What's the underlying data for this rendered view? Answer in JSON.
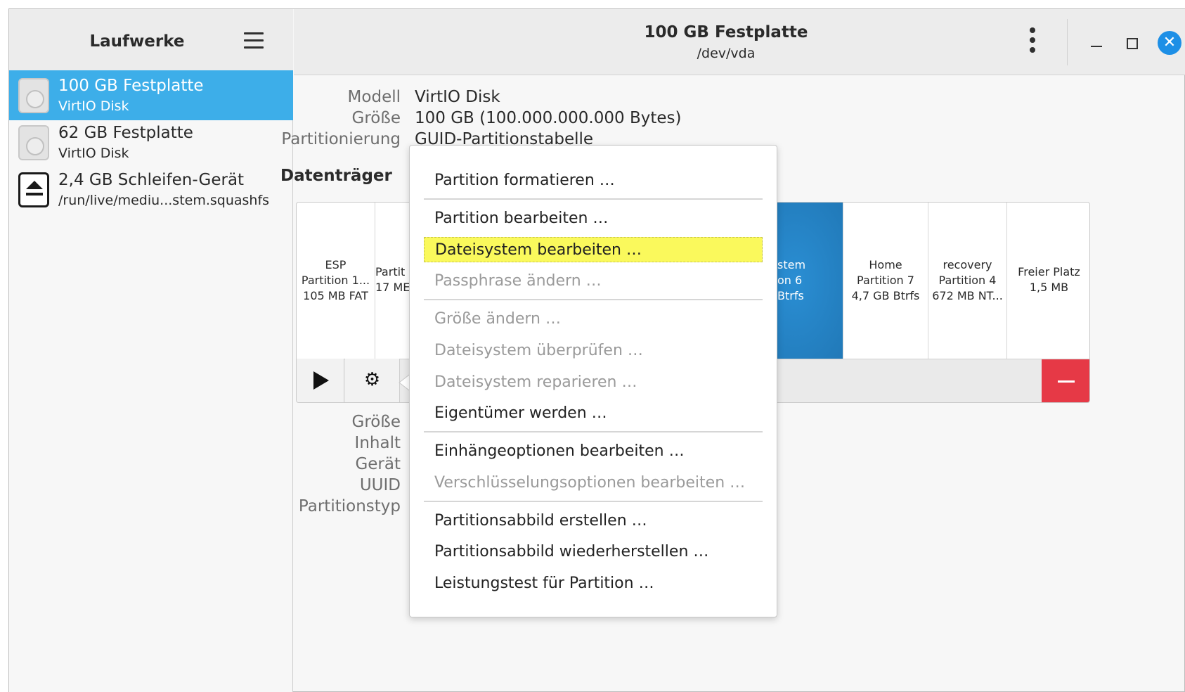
{
  "sidebar": {
    "title": "Laufwerke",
    "drives": [
      {
        "name": "100 GB Festplatte",
        "sub": "VirtIO Disk",
        "icon": "hard-disk-icon",
        "selected": true
      },
      {
        "name": "62 GB Festplatte",
        "sub": "VirtIO Disk",
        "icon": "hard-disk-icon",
        "selected": false
      },
      {
        "name": "2,4 GB Schleifen-Gerät",
        "sub": "/run/live/mediu...stem.squashfs",
        "icon": "eject-icon",
        "selected": false
      }
    ]
  },
  "header": {
    "title": "100 GB Festplatte",
    "subtitle": "/dev/vda",
    "close_glyph": "✕"
  },
  "disk_info": {
    "model_label": "Modell",
    "model_value": "VirtIO Disk",
    "size_label": "Größe",
    "size_value": "100 GB (100.000.000.000 Bytes)",
    "partitioning_label": "Partitionierung",
    "partitioning_value": "GUID-Partitionstabelle"
  },
  "volumes": {
    "title": "Datenträger",
    "segments": [
      {
        "lines": [
          "ESP",
          "Partition 1...",
          "105 MB FAT"
        ]
      },
      {
        "lines": [
          "Partit",
          "17 ME"
        ]
      },
      {
        "lines": [
          "stem",
          "on 6",
          "Btrfs"
        ],
        "selected": true
      },
      {
        "lines": [
          "Home",
          "Partition 7",
          "4,7 GB Btrfs"
        ]
      },
      {
        "lines": [
          "recovery",
          "Partition 4",
          "672 MB NT..."
        ]
      },
      {
        "lines": [
          "Freier Platz",
          "1,5 MB"
        ]
      }
    ],
    "gear_glyph": "⚙"
  },
  "partition_labels": [
    "Größe",
    "Inhalt",
    "Gerät",
    "UUID",
    "Partitionstyp"
  ],
  "menu": {
    "items": [
      {
        "label": "Partition formatieren …",
        "enabled": true
      },
      {
        "label": "Partition bearbeiten …",
        "enabled": true
      },
      {
        "label": "Dateisystem bearbeiten …",
        "enabled": true,
        "highlighted": true
      },
      {
        "label": "Passphrase ändern …",
        "enabled": false
      },
      {
        "label": "Größe ändern …",
        "enabled": false
      },
      {
        "label": "Dateisystem überprüfen …",
        "enabled": false
      },
      {
        "label": "Dateisystem reparieren …",
        "enabled": false
      },
      {
        "label": "Eigentümer werden …",
        "enabled": true
      },
      {
        "label": "Einhängeoptionen bearbeiten …",
        "enabled": true
      },
      {
        "label": "Verschlüsselungsoptionen bearbeiten …",
        "enabled": false
      },
      {
        "label": "Partitionsabbild erstellen …",
        "enabled": true
      },
      {
        "label": "Partitionsabbild wiederherstellen …",
        "enabled": true
      },
      {
        "label": "Leistungstest für Partition …",
        "enabled": true
      }
    ]
  },
  "colors": {
    "accent": "#3daee9",
    "selected_partition": "#2179b8",
    "highlight": "#faf95c",
    "remove": "#e63946",
    "close": "#1d8fe6"
  }
}
